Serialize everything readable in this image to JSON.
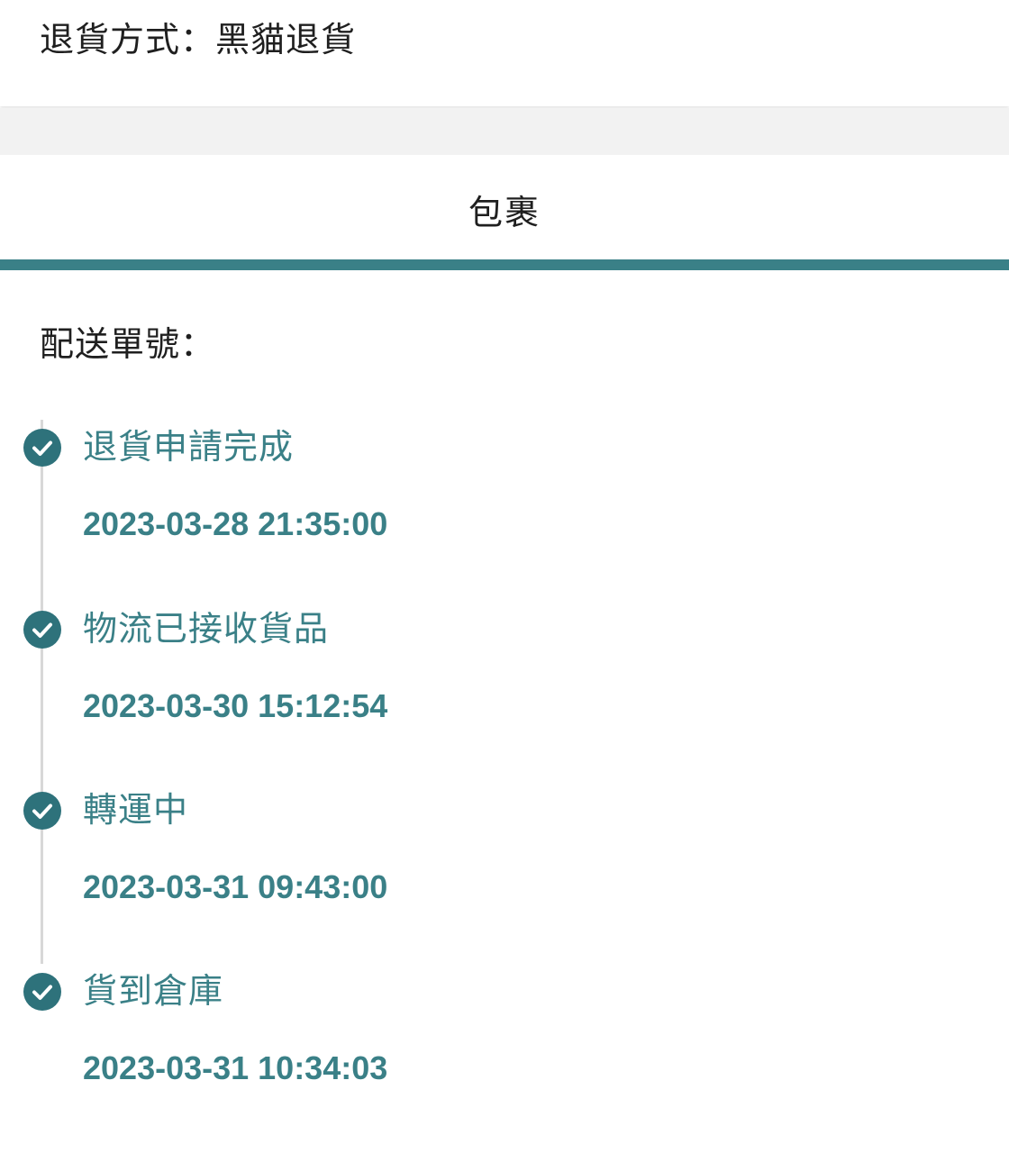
{
  "return_method": {
    "label": "退貨方式：",
    "value": "黑貓退貨"
  },
  "tab": {
    "label": "包裹",
    "accent_color": "#3a8087"
  },
  "tracking": {
    "label": "配送單號：",
    "value": "",
    "value_obscured": true
  },
  "timeline": {
    "steps": [
      {
        "title": "退貨申請完成",
        "time": "2023-03-28 21:35:00",
        "status": "done"
      },
      {
        "title": "物流已接收貨品",
        "time": "2023-03-30 15:12:54",
        "status": "done"
      },
      {
        "title": "轉運中",
        "time": "2023-03-31 09:43:00",
        "status": "done"
      },
      {
        "title": "貨到倉庫",
        "time": "2023-03-31 10:34:03",
        "status": "done"
      }
    ],
    "icon": "check-circle-icon",
    "color": "#2e727b"
  }
}
